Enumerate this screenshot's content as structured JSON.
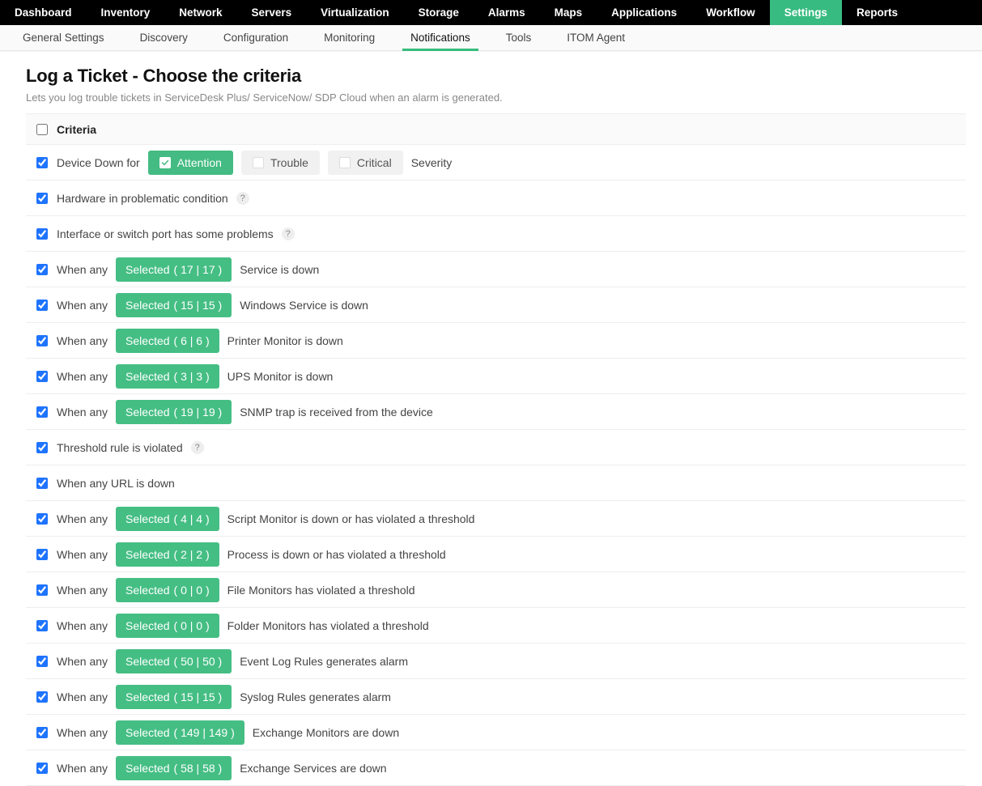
{
  "main_nav": {
    "items": [
      {
        "label": "Dashboard"
      },
      {
        "label": "Inventory"
      },
      {
        "label": "Network"
      },
      {
        "label": "Servers"
      },
      {
        "label": "Virtualization"
      },
      {
        "label": "Storage"
      },
      {
        "label": "Alarms"
      },
      {
        "label": "Maps"
      },
      {
        "label": "Applications"
      },
      {
        "label": "Workflow"
      },
      {
        "label": "Settings",
        "active": true
      },
      {
        "label": "Reports"
      }
    ]
  },
  "sub_nav": {
    "items": [
      {
        "label": "General Settings"
      },
      {
        "label": "Discovery"
      },
      {
        "label": "Configuration"
      },
      {
        "label": "Monitoring"
      },
      {
        "label": "Notifications",
        "active": true
      },
      {
        "label": "Tools"
      },
      {
        "label": "ITOM Agent"
      }
    ]
  },
  "page": {
    "title": "Log a Ticket - Choose the criteria",
    "subtitle": "Lets you log trouble tickets in ServiceDesk Plus/ ServiceNow/ SDP Cloud when an alarm is generated."
  },
  "table": {
    "header_label": "Criteria",
    "severity_row": {
      "prefix": "Device Down for",
      "options": [
        {
          "label": "Attention",
          "checked": true
        },
        {
          "label": "Trouble",
          "checked": false
        },
        {
          "label": "Critical",
          "checked": false
        }
      ],
      "suffix": "Severity"
    },
    "labels": {
      "when_any": "When any",
      "selected": "Selected"
    },
    "rows": [
      {
        "type": "severity"
      },
      {
        "type": "text",
        "text": "Hardware in problematic condition",
        "help": true
      },
      {
        "type": "text",
        "text": "Interface or switch port has some problems",
        "help": true
      },
      {
        "type": "selected",
        "count": "( 17 | 17 )",
        "text": "Service is down"
      },
      {
        "type": "selected",
        "count": "( 15 | 15 )",
        "text": "Windows Service is down"
      },
      {
        "type": "selected",
        "count": "( 6 | 6 )",
        "text": "Printer Monitor is down"
      },
      {
        "type": "selected",
        "count": "( 3 | 3 )",
        "text": "UPS Monitor is down"
      },
      {
        "type": "selected",
        "count": "( 19 | 19 )",
        "text": "SNMP trap is received from the device"
      },
      {
        "type": "text",
        "text": "Threshold rule is violated",
        "help": true
      },
      {
        "type": "text",
        "text": "When any URL is down"
      },
      {
        "type": "selected",
        "count": "( 4 | 4 )",
        "text": "Script Monitor is down or has violated a threshold"
      },
      {
        "type": "selected",
        "count": "( 2 | 2 )",
        "text": "Process is down or has violated a threshold"
      },
      {
        "type": "selected",
        "count": "( 0 | 0 )",
        "text": "File Monitors has violated a threshold"
      },
      {
        "type": "selected",
        "count": "( 0 | 0 )",
        "text": "Folder Monitors has violated a threshold"
      },
      {
        "type": "selected",
        "count": "( 50 | 50 )",
        "text": "Event Log Rules generates alarm"
      },
      {
        "type": "selected",
        "count": "( 15 | 15 )",
        "text": "Syslog Rules generates alarm"
      },
      {
        "type": "selected",
        "count": "( 149 | 149 )",
        "text": "Exchange Monitors are down"
      },
      {
        "type": "selected",
        "count": "( 58 | 58 )",
        "text": "Exchange Services are down"
      }
    ]
  }
}
